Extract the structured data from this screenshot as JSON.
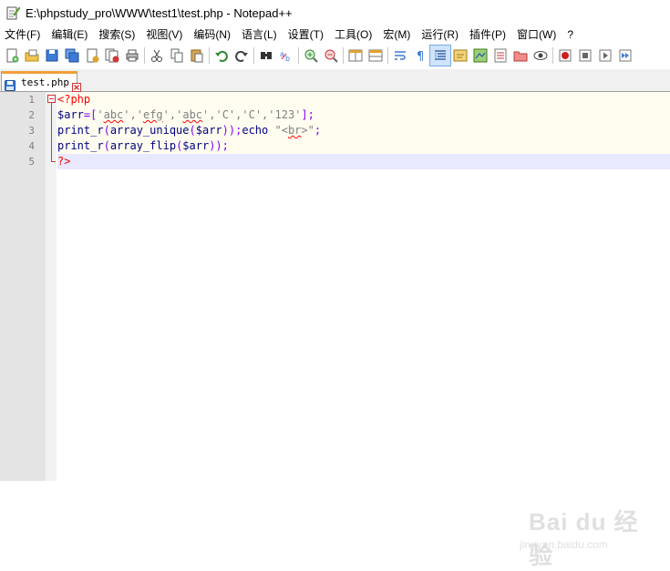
{
  "window": {
    "title": "E:\\phpstudy_pro\\WWW\\test1\\test.php - Notepad++"
  },
  "menu": [
    {
      "label": "文件(F)"
    },
    {
      "label": "编辑(E)"
    },
    {
      "label": "搜索(S)"
    },
    {
      "label": "视图(V)"
    },
    {
      "label": "编码(N)"
    },
    {
      "label": "语言(L)"
    },
    {
      "label": "设置(T)"
    },
    {
      "label": "工具(O)"
    },
    {
      "label": "宏(M)"
    },
    {
      "label": "运行(R)"
    },
    {
      "label": "插件(P)"
    },
    {
      "label": "窗口(W)"
    },
    {
      "label": "?"
    }
  ],
  "toolbar": {
    "icons": [
      "new-file-icon",
      "open-file-icon",
      "save-icon",
      "save-all-icon",
      "close-icon",
      "close-all-icon",
      "print-icon",
      "cut-icon",
      "copy-icon",
      "paste-icon",
      "undo-icon",
      "redo-icon",
      "find-icon",
      "replace-icon",
      "zoom-in-icon",
      "zoom-out-icon",
      "sync-vertical-icon",
      "sync-horizontal-icon",
      "word-wrap-icon",
      "show-all-chars-icon",
      "indent-guide-icon",
      "user-language-icon",
      "document-map-icon",
      "function-list-icon",
      "folder-workspace-icon",
      "monitoring-icon",
      "record-macro-icon",
      "stop-record-icon",
      "play-macro-icon",
      "run-macro-multiple-icon"
    ],
    "active_index": 20
  },
  "tabs": [
    {
      "label": "test.php",
      "active": true
    }
  ],
  "editor": {
    "line_numbers": [
      "1",
      "2",
      "3",
      "4",
      "5"
    ],
    "lines": [
      {
        "tokens": [
          {
            "t": "<?php",
            "c": "tag"
          }
        ]
      },
      {
        "tokens": [
          {
            "t": "$arr",
            "c": "var"
          },
          {
            "t": "=[",
            "c": "op"
          },
          {
            "t": "'",
            "c": "str"
          },
          {
            "t": "abc",
            "c": "str",
            "sq": true
          },
          {
            "t": "','",
            "c": "str"
          },
          {
            "t": "efg",
            "c": "str",
            "sq": true
          },
          {
            "t": "','",
            "c": "str"
          },
          {
            "t": "abc",
            "c": "str",
            "sq": true
          },
          {
            "t": "','C','C','123'",
            "c": "str"
          },
          {
            "t": "];",
            "c": "op"
          }
        ]
      },
      {
        "tokens": [
          {
            "t": "print_r",
            "c": "fn"
          },
          {
            "t": "(",
            "c": "op"
          },
          {
            "t": "array_unique",
            "c": "fn"
          },
          {
            "t": "(",
            "c": "op"
          },
          {
            "t": "$arr",
            "c": "var"
          },
          {
            "t": "));",
            "c": "op"
          },
          {
            "t": "echo",
            "c": "kw"
          },
          {
            "t": " \"<",
            "c": "str"
          },
          {
            "t": "br",
            "c": "str",
            "sq": true
          },
          {
            "t": ">\"",
            "c": "str"
          },
          {
            "t": ";",
            "c": "op"
          }
        ]
      },
      {
        "tokens": [
          {
            "t": "print_r",
            "c": "fn"
          },
          {
            "t": "(",
            "c": "op"
          },
          {
            "t": "array_flip",
            "c": "fn"
          },
          {
            "t": "(",
            "c": "op"
          },
          {
            "t": "$arr",
            "c": "var"
          },
          {
            "t": "));",
            "c": "op"
          }
        ]
      },
      {
        "tokens": [
          {
            "t": "?>",
            "c": "tag"
          }
        ]
      }
    ],
    "current_line": 5
  },
  "watermark": {
    "main": "Bai du 经验",
    "sub": "jingyan.baidu.com"
  },
  "colors": {
    "tab_accent": "#f29e38",
    "current_line": "#e8e8ff",
    "fold": "#d23535"
  }
}
